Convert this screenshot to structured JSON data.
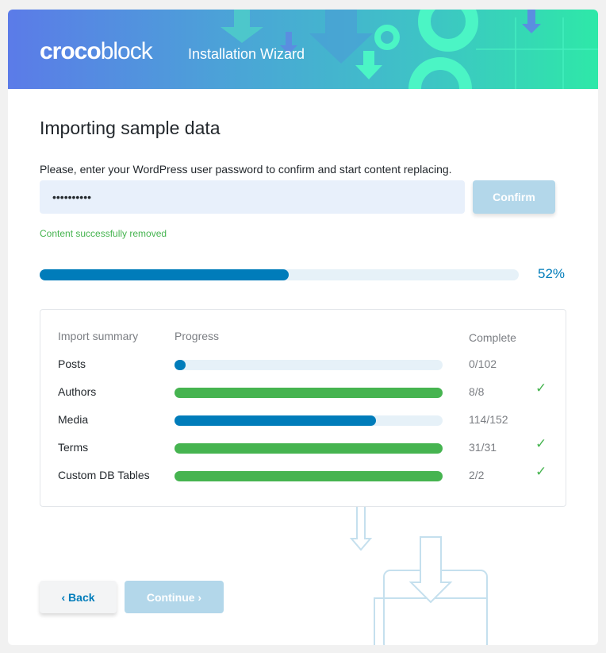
{
  "header": {
    "logo_bold": "croco",
    "logo_light": "block",
    "title": "Installation Wizard"
  },
  "page": {
    "title": "Importing sample data",
    "prompt": "Please, enter your WordPress user password to confirm and start content replacing.",
    "password_value": "••••••••••",
    "confirm_label": "Confirm",
    "status": "Content successfully removed",
    "overall_progress_percent": 52,
    "overall_progress_label": "52%"
  },
  "summary": {
    "headers": {
      "name": "Import summary",
      "progress": "Progress",
      "complete": "Complete"
    },
    "rows": [
      {
        "label": "Posts",
        "count": "0/102",
        "progress": 0,
        "done": false
      },
      {
        "label": "Authors",
        "count": "8/8",
        "progress": 100,
        "done": true
      },
      {
        "label": "Media",
        "count": "114/152",
        "progress": 75,
        "done": false
      },
      {
        "label": "Terms",
        "count": "31/31",
        "progress": 100,
        "done": true
      },
      {
        "label": "Custom DB Tables",
        "count": "2/2",
        "progress": 100,
        "done": true
      }
    ]
  },
  "nav": {
    "back_label": "Back",
    "continue_label": "Continue"
  },
  "colors": {
    "accent": "#007cba",
    "success": "#46b450",
    "track": "#e6f1f8"
  }
}
